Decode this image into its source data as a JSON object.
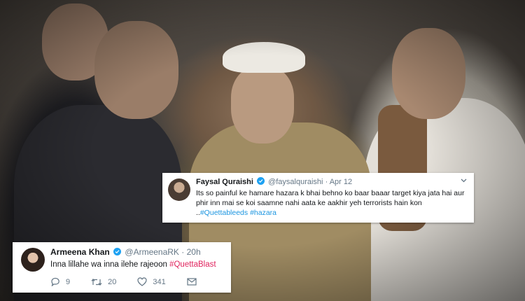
{
  "tweet_top": {
    "name": "Faysal Quraishi",
    "handle": "@faysalquraishi",
    "separator": "·",
    "date": "Apr 12",
    "text": "Its so painful ke hamare hazara k bhai behno ko baar baaar target kiya jata hai aur phir inn mai se koi saamne nahi aata ke aakhir yeh terrorists hain kon ..",
    "hashtags": [
      "#Quettableeds",
      "#hazara"
    ]
  },
  "tweet_bottom": {
    "name": "Armeena Khan",
    "handle": "@ArmeenaRK",
    "separator": "·",
    "time": "20h",
    "text": "Inna lillahe wa inna ilehe rajeoon",
    "hashtag": "#QuettaBlast",
    "replies": "9",
    "retweets": "20",
    "likes": "341"
  },
  "colors": {
    "link": "#1b95e0",
    "hashtag_red": "#e0245e",
    "verified": "#1da1f2"
  },
  "icons": [
    "verified-icon",
    "chevron-down-icon",
    "reply-icon",
    "retweet-icon",
    "like-icon",
    "message-icon"
  ]
}
